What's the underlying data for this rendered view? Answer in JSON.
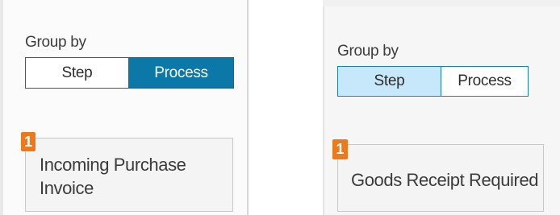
{
  "left_panel": {
    "group_label": "Group by",
    "segments": {
      "step": "Step",
      "process": "Process"
    },
    "selected": "Process",
    "card": {
      "badge": "1",
      "title": "Incoming Purchase Invoice"
    }
  },
  "right_panel": {
    "group_label": "Group by",
    "segments": {
      "step": "Step",
      "process": "Process"
    },
    "selected": "Step",
    "card": {
      "badge": "1",
      "title": "Goods Receipt Required"
    }
  },
  "colors": {
    "selected_dark": "#0b78a8",
    "selected_light": "#c6e8fa",
    "badge": "#ec7a1c",
    "border": "#0b6f9e"
  }
}
